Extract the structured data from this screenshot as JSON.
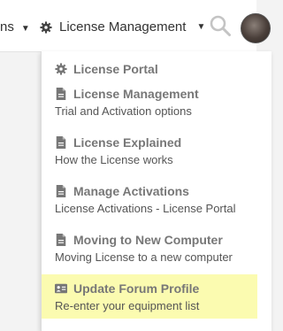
{
  "nav": {
    "prev_label": "ns",
    "current_label": "License Management",
    "icons": {
      "gear": "gear-icon",
      "caret": "chevron-down-icon",
      "search": "search-icon",
      "avatar": "user-avatar"
    }
  },
  "menu": {
    "items": [
      {
        "title": "License Portal",
        "icon": "gear-icon"
      },
      {
        "title": "License Management",
        "desc": "Trial and Activation options",
        "icon": "document-icon"
      },
      {
        "title": "License Explained",
        "desc": "How the License works",
        "icon": "document-icon"
      },
      {
        "title": "Manage Activations",
        "desc": "License Activations - License Portal",
        "icon": "document-icon"
      },
      {
        "title": "Moving to New Computer",
        "desc": "Moving License to a new computer",
        "icon": "document-icon"
      },
      {
        "title": "Update Forum Profile",
        "desc": "Re-enter your equipment list",
        "icon": "id-card-icon",
        "highlighted": true
      }
    ]
  },
  "colors": {
    "highlight": "#fbfbb0",
    "item_title": "#777777",
    "item_desc": "#555555",
    "icon": "#777777"
  }
}
